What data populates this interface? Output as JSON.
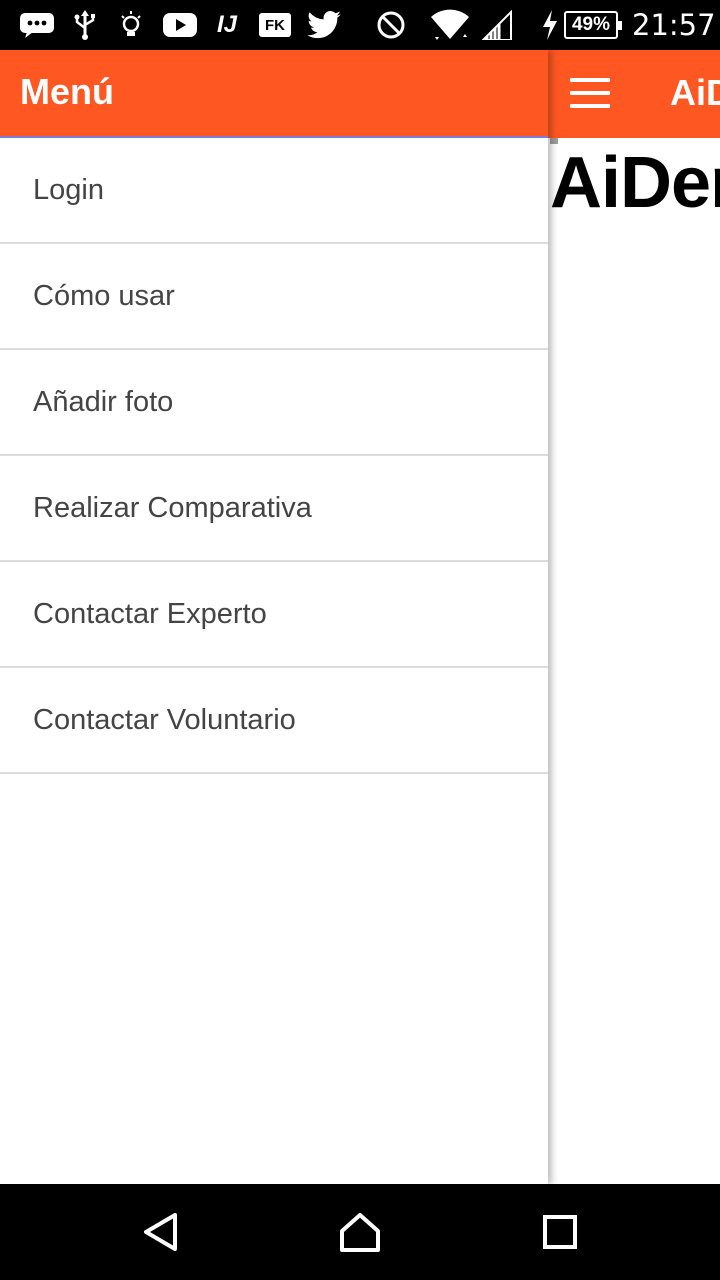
{
  "status_bar": {
    "icons": [
      "message-icon",
      "usb-icon",
      "lightbulb-icon",
      "youtube-icon",
      "intellij-icon",
      "fk-icon",
      "twitter-icon",
      "do-not-disturb-icon",
      "wifi-icon",
      "signal-icon",
      "charging-icon"
    ],
    "fk_label": "FK",
    "ij_label": "IJ",
    "battery": "49%",
    "time": "21:57"
  },
  "drawer": {
    "title": "Menú",
    "items": [
      {
        "label": "Login"
      },
      {
        "label": "Cómo usar"
      },
      {
        "label": "Añadir foto"
      },
      {
        "label": "Realizar Comparativa"
      },
      {
        "label": "Contactar Experto"
      },
      {
        "label": "Contactar Voluntario"
      }
    ]
  },
  "app": {
    "toolbar_title": "AiD",
    "heading": "AiDer"
  },
  "colors": {
    "accent": "#ff5722",
    "header_border": "#7c7cdb"
  }
}
